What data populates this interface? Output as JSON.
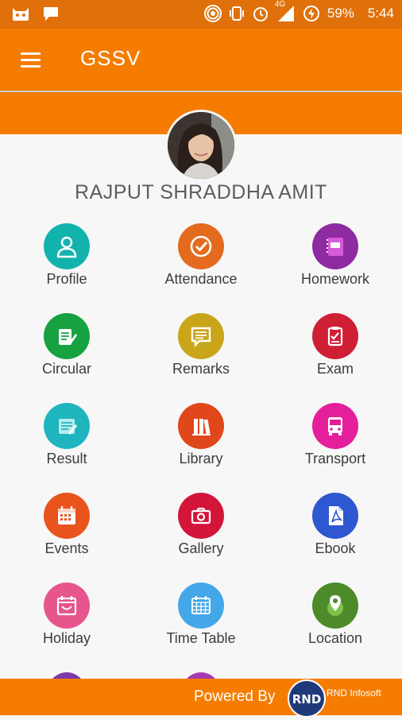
{
  "status": {
    "battery": "59%",
    "time": "5:44",
    "network": "4G"
  },
  "app": {
    "title": "GSSV"
  },
  "student": {
    "name": "RAJPUT SHRADDHA AMIT"
  },
  "menu": [
    {
      "label": "Profile",
      "color": "#13b3ad",
      "icon": "person-icon"
    },
    {
      "label": "Attendance",
      "color": "#e46b1e",
      "icon": "checkmark-icon"
    },
    {
      "label": "Homework",
      "color": "#8e2ba0",
      "icon": "notebook-icon"
    },
    {
      "label": "Circular",
      "color": "#17a140",
      "icon": "document-pencil-icon"
    },
    {
      "label": "Remarks",
      "color": "#c9a51a",
      "icon": "speech-bubble-icon"
    },
    {
      "label": "Exam",
      "color": "#cf1f35",
      "icon": "clipboard-icon"
    },
    {
      "label": "Result",
      "color": "#1fb5bf",
      "icon": "report-icon"
    },
    {
      "label": "Library",
      "color": "#e0471b",
      "icon": "books-icon"
    },
    {
      "label": "Transport",
      "color": "#e51e9b",
      "icon": "bus-icon"
    },
    {
      "label": "Events",
      "color": "#e8541c",
      "icon": "calendar-icon"
    },
    {
      "label": "Gallery",
      "color": "#d3153a",
      "icon": "camera-icon"
    },
    {
      "label": "Ebook",
      "color": "#2f57d0",
      "icon": "pdf-icon"
    },
    {
      "label": "Holiday",
      "color": "#e7558d",
      "icon": "holiday-calendar-icon"
    },
    {
      "label": "Time Table",
      "color": "#44a8e8",
      "icon": "grid-calendar-icon"
    },
    {
      "label": "Location",
      "color": "#4d8b2a",
      "icon": "map-pin-icon"
    }
  ],
  "footer": {
    "powered_by": "Powered By",
    "brand": "RND Infosoft"
  }
}
